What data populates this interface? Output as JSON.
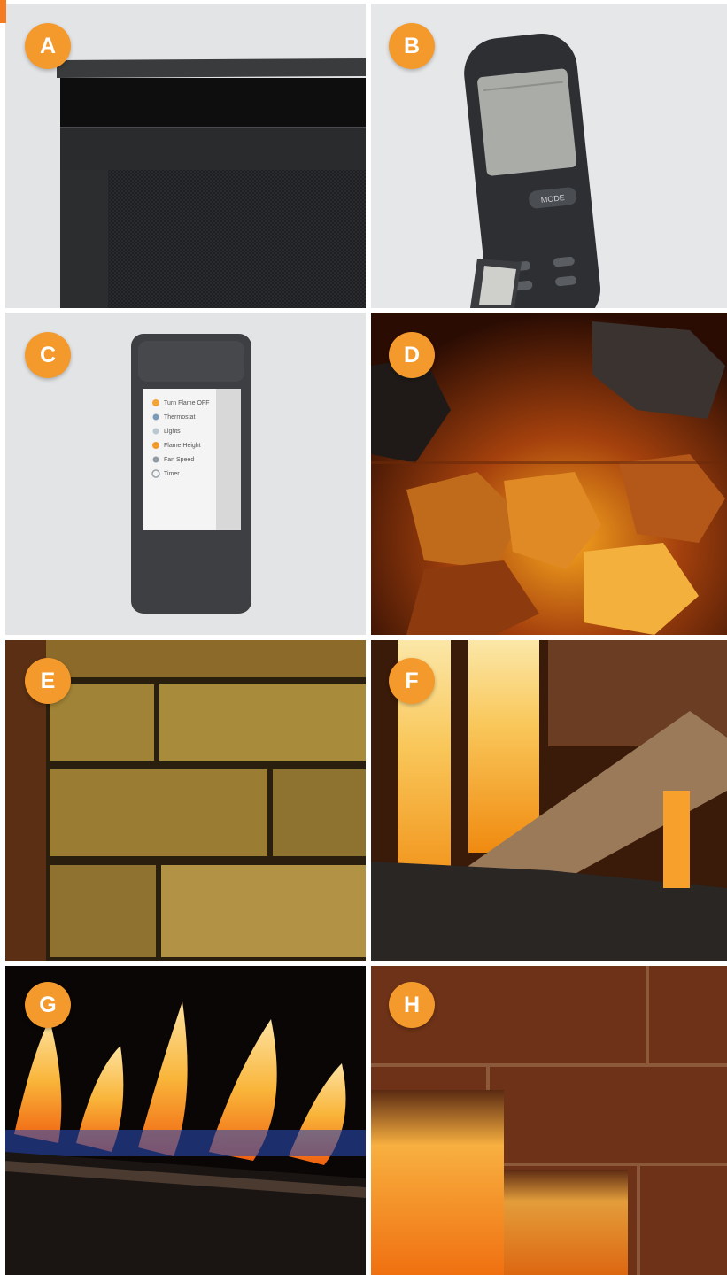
{
  "accent_color": "#f47b20",
  "badge_color": "#f49a2c",
  "tiles": [
    {
      "label": "A",
      "subject": "black mesh screen frame corner"
    },
    {
      "label": "B",
      "subject": "handheld remote with LCD and buttons"
    },
    {
      "label": "C",
      "subject": "touchscreen remote"
    },
    {
      "label": "D",
      "subject": "glowing glass embers"
    },
    {
      "label": "E",
      "subject": "stacked stone brick liner"
    },
    {
      "label": "F",
      "subject": "log set with flames"
    },
    {
      "label": "G",
      "subject": "linear flame over glass media"
    },
    {
      "label": "H",
      "subject": "red brick liner with flames"
    }
  ],
  "remote_c": {
    "menu": [
      "Turn Flame OFF",
      "Thermostat",
      "Lights",
      "Flame Height",
      "Fan Speed",
      "Timer"
    ]
  },
  "remote_b": {
    "mode_label": "MODE"
  }
}
